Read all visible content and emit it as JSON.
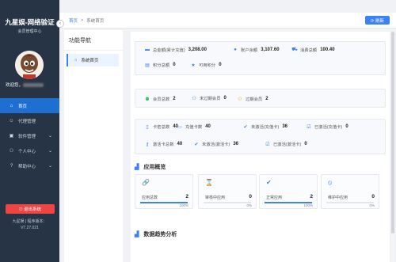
{
  "brand": {
    "title": "九星娱-网络验证",
    "subtitle": "会员管理中心",
    "collapse": "‹"
  },
  "user": {
    "welcome_prefix": "欢迎您，"
  },
  "menu": [
    {
      "icon": "home-icon",
      "glyph": "⌂",
      "label": "首页",
      "chev": ""
    },
    {
      "icon": "user-icon",
      "glyph": "☺",
      "label": "代理管理",
      "chev": ""
    },
    {
      "icon": "box-icon",
      "glyph": "▣",
      "label": "软件管理",
      "chev": "⌄"
    },
    {
      "icon": "person-icon",
      "glyph": "⚇",
      "label": "个人中心",
      "chev": "⌄"
    },
    {
      "icon": "help-icon",
      "glyph": "?",
      "label": "帮助中心",
      "chev": "⌄"
    }
  ],
  "logout_label": "⎋ 退出系统",
  "footer": {
    "line1": "九星娱 | 程序版本：",
    "line2": "V7.27.021"
  },
  "breadcrumb": {
    "home": "首页",
    "sep": ">",
    "current": "系统首页"
  },
  "refresh_label": "⟳ 刷新",
  "nav": {
    "title": "功能导航",
    "item": "系统首页"
  },
  "stats1": [
    {
      "icon": "money-icon",
      "glyph": "▬",
      "color": "#3b82f6",
      "label": "总金额(累计充值)",
      "value": "3,208.00"
    },
    {
      "icon": "user-icon",
      "glyph": "●",
      "color": "#3b82f6",
      "label": "账户余额",
      "value": "3,107.60"
    },
    {
      "icon": "cart-icon",
      "glyph": "⛟",
      "color": "#3b82f6",
      "label": "消费总额",
      "value": "100.40"
    },
    {
      "icon": "points-icon",
      "glyph": "▤",
      "color": "#3b82f6",
      "label": "积分总额",
      "value": "0"
    },
    {
      "icon": "star-icon",
      "glyph": "★",
      "color": "#3b82f6",
      "label": "可用积分",
      "value": "0"
    }
  ],
  "stats2": [
    {
      "icon": "users-icon",
      "glyph": "⚉",
      "color": "#22c55e",
      "label": "会员总数",
      "value": "2"
    },
    {
      "icon": "user-add-icon",
      "glyph": "⚇",
      "color": "#3b82f6",
      "label": "未过期会员",
      "value": "0"
    },
    {
      "icon": "user-expired-icon",
      "glyph": "⚇",
      "color": "#f59e0b",
      "label": "过期会员",
      "value": "2"
    }
  ],
  "stats3": [
    {
      "icon": "phone-icon",
      "glyph": "▯",
      "color": "#3b82f6",
      "label": "卡密总数",
      "value": "40"
    },
    {
      "icon": "card-icon",
      "glyph": "▭",
      "color": "#3b82f6",
      "label": "充值卡数",
      "value": "40"
    },
    {
      "icon": "check-circle-icon",
      "glyph": "✔",
      "color": "#3b82f6",
      "label": "未激活(充值卡)",
      "value": "36"
    },
    {
      "icon": "check-square-icon",
      "glyph": "☑",
      "color": "#3b82f6",
      "label": "已激活(充值卡)",
      "value": "0"
    },
    {
      "icon": "key-icon",
      "glyph": "⚷",
      "color": "#3b82f6",
      "label": "激活卡总数",
      "value": "40"
    },
    {
      "icon": "check-circle-icon",
      "glyph": "✔",
      "color": "#3b82f6",
      "label": "未激活(激活卡)",
      "value": "36"
    },
    {
      "icon": "check-square-icon",
      "glyph": "☑",
      "color": "#3b82f6",
      "label": "已激活(激活卡)",
      "value": "0"
    }
  ],
  "app_overview": {
    "title": "应用概览",
    "glyph": "▟"
  },
  "cards": [
    {
      "icon": "link-icon",
      "glyph": "🔗",
      "color": "#3b82f6",
      "label": "应用总数",
      "value": "2",
      "pct": "100%",
      "fill": 1
    },
    {
      "icon": "hourglass-icon",
      "glyph": "⌛",
      "color": "#2563eb",
      "label": "审核中应用",
      "value": "0",
      "pct": "0%",
      "fill": 0
    },
    {
      "icon": "check-icon",
      "glyph": "✔",
      "color": "#3b82f6",
      "label": "正常应用",
      "value": "2",
      "pct": "100%",
      "fill": 1
    },
    {
      "icon": "ban-icon",
      "glyph": "⦸",
      "color": "#3b82f6",
      "label": "维护中应用",
      "value": "0",
      "pct": "0%",
      "fill": 0
    }
  ],
  "trend": {
    "title": "数据趋势分析",
    "glyph": "▟"
  }
}
